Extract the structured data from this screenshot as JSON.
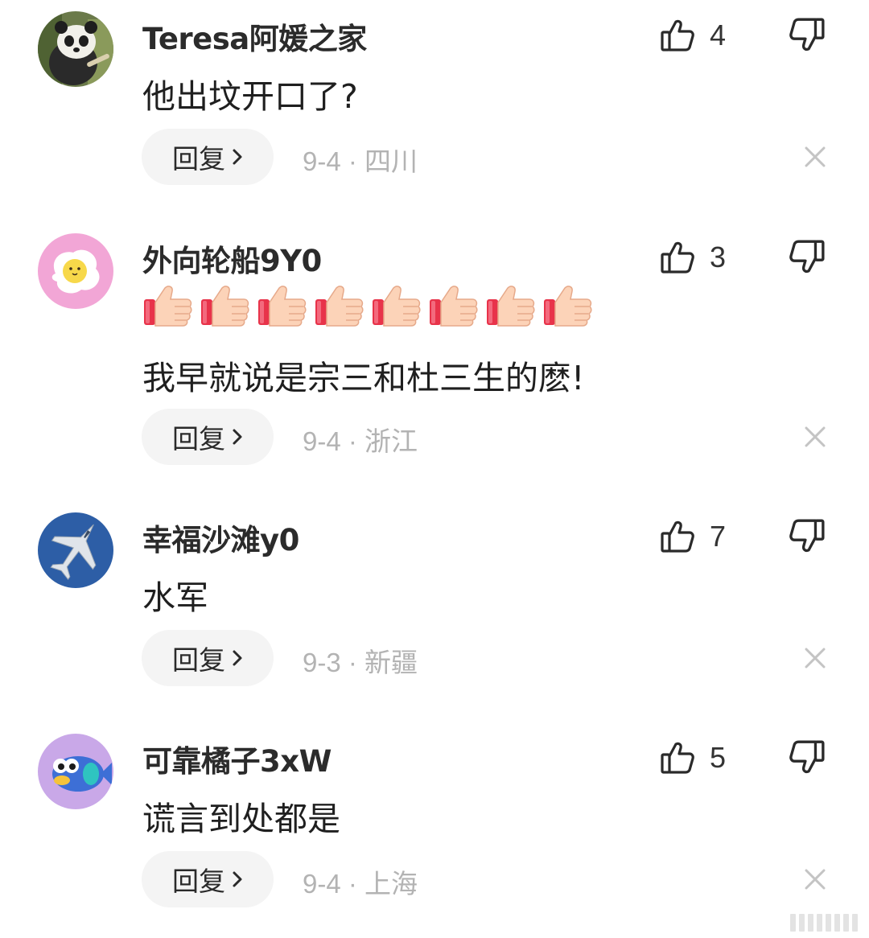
{
  "comments": [
    {
      "username": "Teresa阿媛之家",
      "avatar_icon": "panda-avatar-icon",
      "likes": "4",
      "lines": [
        "他出坟开口了?"
      ],
      "emoji_count": 0,
      "reply_label": "回复",
      "date": "9-4",
      "location": "四川"
    },
    {
      "username": "外向轮船9Y0",
      "avatar_icon": "egg-chick-avatar-icon",
      "likes": "3",
      "emoji_name": "thumbs-up-emoji",
      "emoji_count": 8,
      "lines": [
        "我早就说是宗三和杜三生的麽!"
      ],
      "reply_label": "回复",
      "date": "9-4",
      "location": "浙江"
    },
    {
      "username": "幸福沙滩y0",
      "avatar_icon": "fighter-jet-avatar-icon",
      "likes": "7",
      "lines": [
        "水军"
      ],
      "emoji_count": 0,
      "reply_label": "回复",
      "date": "9-3",
      "location": "新疆"
    },
    {
      "username": "可靠橘子3xW",
      "avatar_icon": "fish-avatar-icon",
      "likes": "5",
      "lines": [
        "谎言到处都是"
      ],
      "emoji_count": 0,
      "reply_label": "回复",
      "date": "9-4",
      "location": "上海"
    }
  ],
  "separator": "·",
  "colors": {
    "username": "#2b2b2b",
    "meta": "#b3b3b3",
    "reply_bg": "#f4f4f4",
    "avatar_pink": "#f2a6d6",
    "avatar_blue": "#2d5ea6",
    "avatar_purple": "#c9a8e8"
  }
}
